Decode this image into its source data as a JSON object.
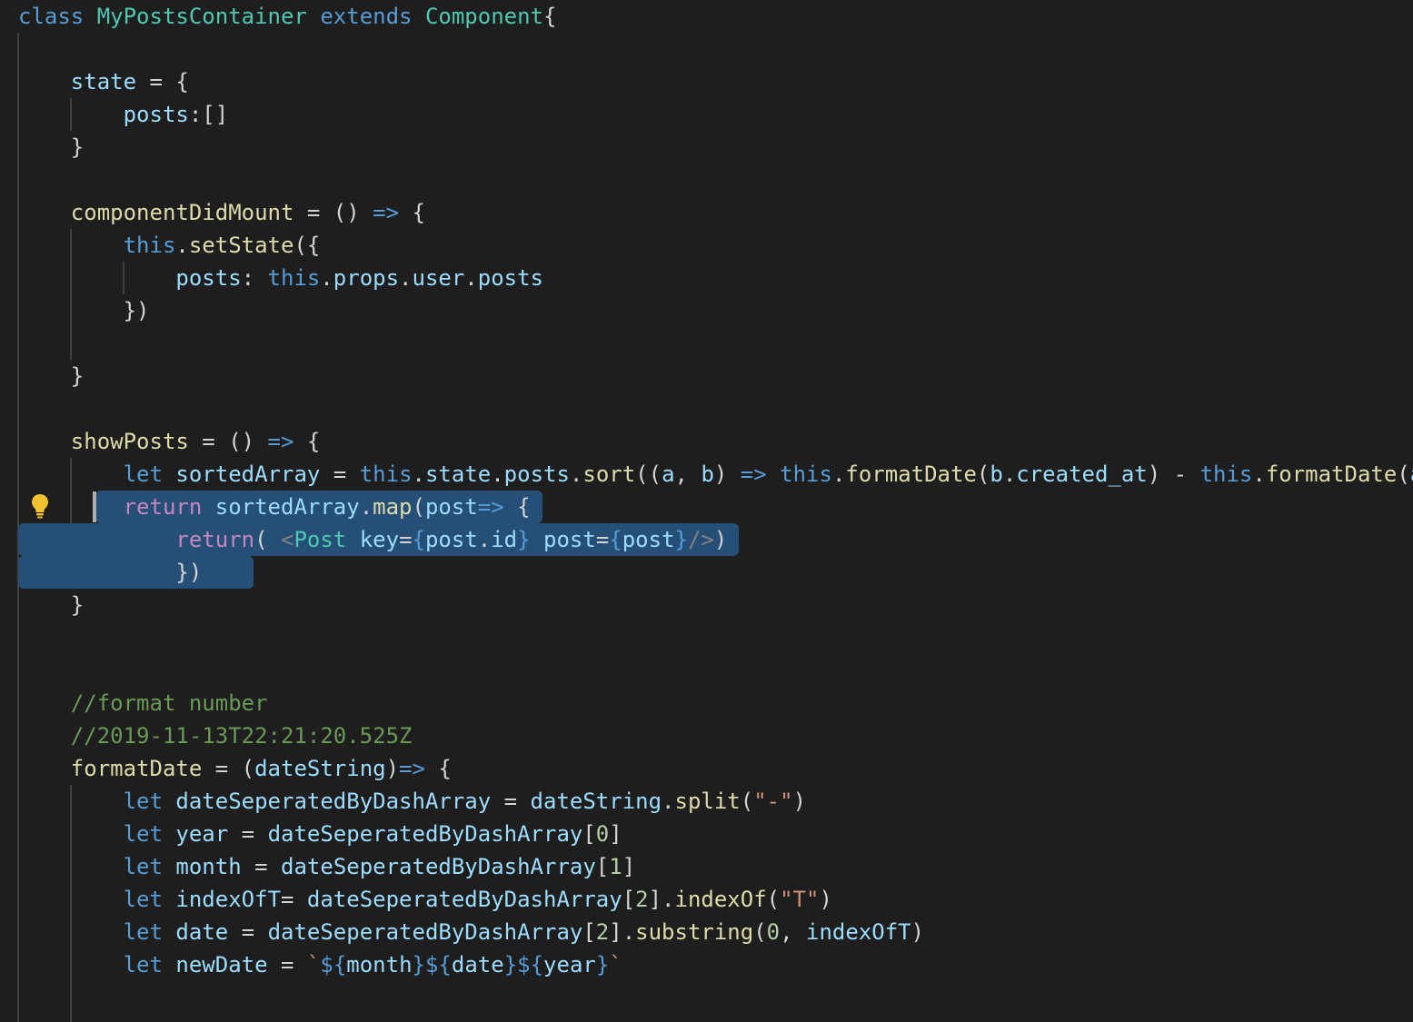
{
  "editor": {
    "language": "javascript",
    "theme": "dark",
    "lines": [
      "class MyPostsContainer extends Component{",
      "",
      "    state = {",
      "        posts:[]",
      "    }",
      "",
      "    componentDidMount = () => {",
      "        this.setState({",
      "            posts: this.props.user.posts",
      "        })",
      "",
      "    }",
      "",
      "    showPosts = () => {",
      "        let sortedArray = this.state.posts.sort((a, b) => this.formatDate(b.created_at) - this.formatDate(a",
      "        return sortedArray.map(post=> {",
      "            return( <Post key={post.id} post={post}/>)",
      "            })",
      "    }",
      "",
      "",
      "    //format number",
      "    //2019-11-13T22:21:20.525Z",
      "    formatDate = (dateString)=> {",
      "        let dateSeperatedByDashArray = dateString.split(\"-\")",
      "        let year = dateSeperatedByDashArray[0]",
      "        let month = dateSeperatedByDashArray[1]",
      "        let indexOfT= dateSeperatedByDashArray[2].indexOf(\"T\")",
      "        let date = dateSeperatedByDashArray[2].substring(0, indexOfT)",
      "        let newDate = `${month}${date}${year}`",
      ""
    ]
  },
  "colors": {
    "background": "#1e1e1e",
    "keyword": "#569cd6",
    "control": "#c586c0",
    "class": "#4ec9b0",
    "function": "#dcdcaa",
    "variable": "#9cdcfe",
    "string": "#ce9178",
    "number": "#b5cea8",
    "comment": "#6a9955",
    "selection": "#264f78"
  },
  "icons": {
    "lightbulb": "lightbulb-icon"
  }
}
